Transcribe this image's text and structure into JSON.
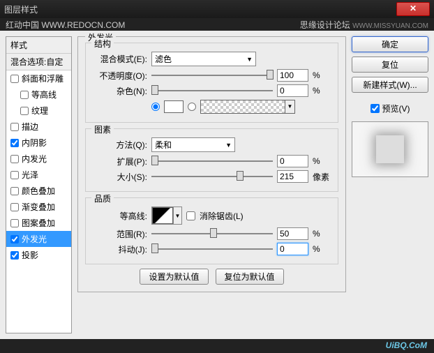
{
  "titlebar": {
    "title": "图层样式",
    "url1": "红动中国  WWW.REDOCN.COM",
    "forum": "思缘设计论坛",
    "url2": "WWW.MISSYUAN.COM",
    "close": "✕"
  },
  "footer": {
    "brand": "UiBQ.CoM"
  },
  "sidebar": {
    "header": "样式",
    "sub": "混合选项:自定",
    "items": [
      {
        "label": "斜面和浮雕",
        "checked": false,
        "indent": false
      },
      {
        "label": "等高线",
        "checked": false,
        "indent": true
      },
      {
        "label": "纹理",
        "checked": false,
        "indent": true
      },
      {
        "label": "描边",
        "checked": false,
        "indent": false
      },
      {
        "label": "内阴影",
        "checked": true,
        "indent": false
      },
      {
        "label": "内发光",
        "checked": false,
        "indent": false
      },
      {
        "label": "光泽",
        "checked": false,
        "indent": false
      },
      {
        "label": "颜色叠加",
        "checked": false,
        "indent": false
      },
      {
        "label": "渐变叠加",
        "checked": false,
        "indent": false
      },
      {
        "label": "图案叠加",
        "checked": false,
        "indent": false
      },
      {
        "label": "外发光",
        "checked": true,
        "indent": false,
        "selected": true
      },
      {
        "label": "投影",
        "checked": true,
        "indent": false
      }
    ]
  },
  "panel": {
    "title": "外发光",
    "structure": {
      "legend": "结构",
      "blend_label": "混合模式(E):",
      "blend_value": "滤色",
      "opacity_label": "不透明度(O):",
      "opacity_value": "100",
      "opacity_unit": "%",
      "noise_label": "杂色(N):",
      "noise_value": "0",
      "noise_unit": "%"
    },
    "elements": {
      "legend": "图素",
      "technique_label": "方法(Q):",
      "technique_value": "柔和",
      "spread_label": "扩展(P):",
      "spread_value": "0",
      "spread_unit": "%",
      "size_label": "大小(S):",
      "size_value": "215",
      "size_unit": "像素"
    },
    "quality": {
      "legend": "品质",
      "contour_label": "等高线:",
      "anti_alias_label": "消除锯齿(L)",
      "range_label": "范围(R):",
      "range_value": "50",
      "range_unit": "%",
      "jitter_label": "抖动(J):",
      "jitter_value": "0",
      "jitter_unit": "%"
    },
    "defaults_btn": "设置为默认值",
    "reset_btn": "复位为默认值"
  },
  "right": {
    "ok": "确定",
    "cancel": "复位",
    "new_style": "新建样式(W)...",
    "preview_label": "预览(V)"
  }
}
